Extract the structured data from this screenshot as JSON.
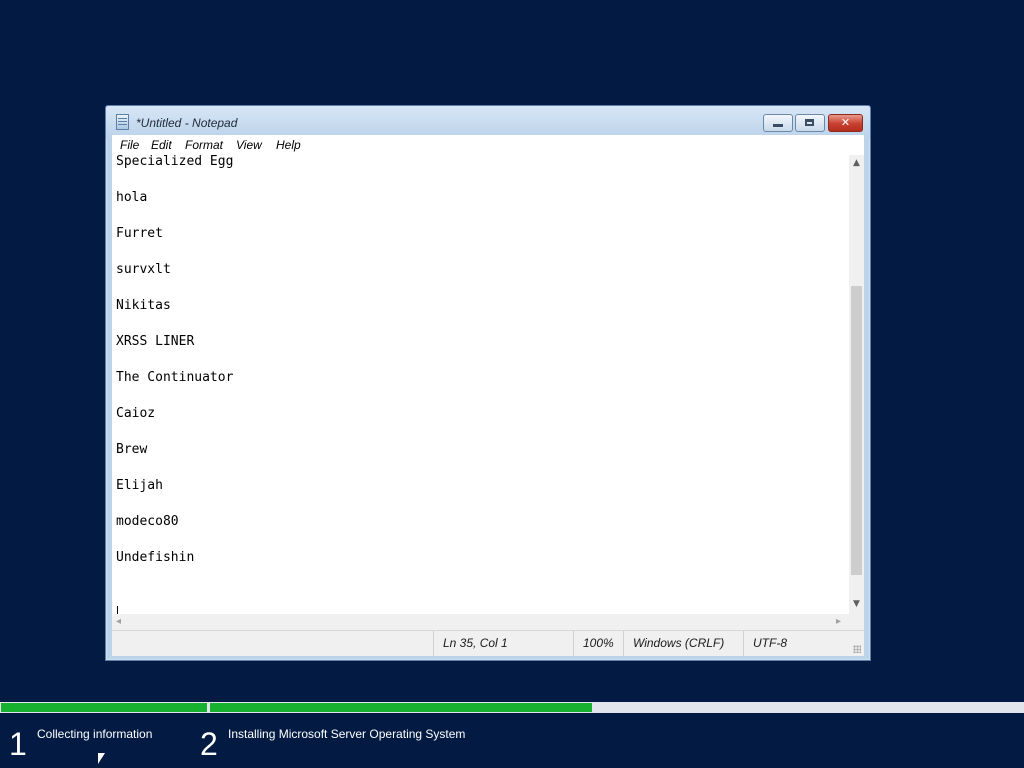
{
  "window": {
    "title": "*Untitled - Notepad"
  },
  "menubar": {
    "items": [
      "File",
      "Edit",
      "Format",
      "View",
      "Help"
    ]
  },
  "editor": {
    "lines": [
      "Specialized Egg",
      "hola",
      "Furret",
      "survxlt",
      "Nikitas",
      "XRSS LINER",
      "The Continuator",
      "Caioz",
      "Brew",
      "Elijah",
      "modeco80",
      "Undefishin"
    ]
  },
  "statusbar": {
    "position": "Ln 35, Col 1",
    "zoom": "100%",
    "line_endings": "Windows (CRLF)",
    "encoding": "UTF-8"
  },
  "setup": {
    "steps": [
      {
        "number": "1",
        "label": "Collecting information",
        "progress": 1.0
      },
      {
        "number": "2",
        "label": "Installing Microsoft Server Operating System",
        "progress": 0.47
      }
    ],
    "progress_color": "#17b02f",
    "background_color": "#031b43"
  },
  "icons": {
    "app": "notepad-icon",
    "minimize": "minimize-icon",
    "maximize": "maximize-icon",
    "close": "close-icon",
    "scroll_up": "chevron-up-icon",
    "scroll_down": "chevron-down-icon",
    "scroll_left": "chevron-left-icon",
    "scroll_right": "chevron-right-icon"
  }
}
